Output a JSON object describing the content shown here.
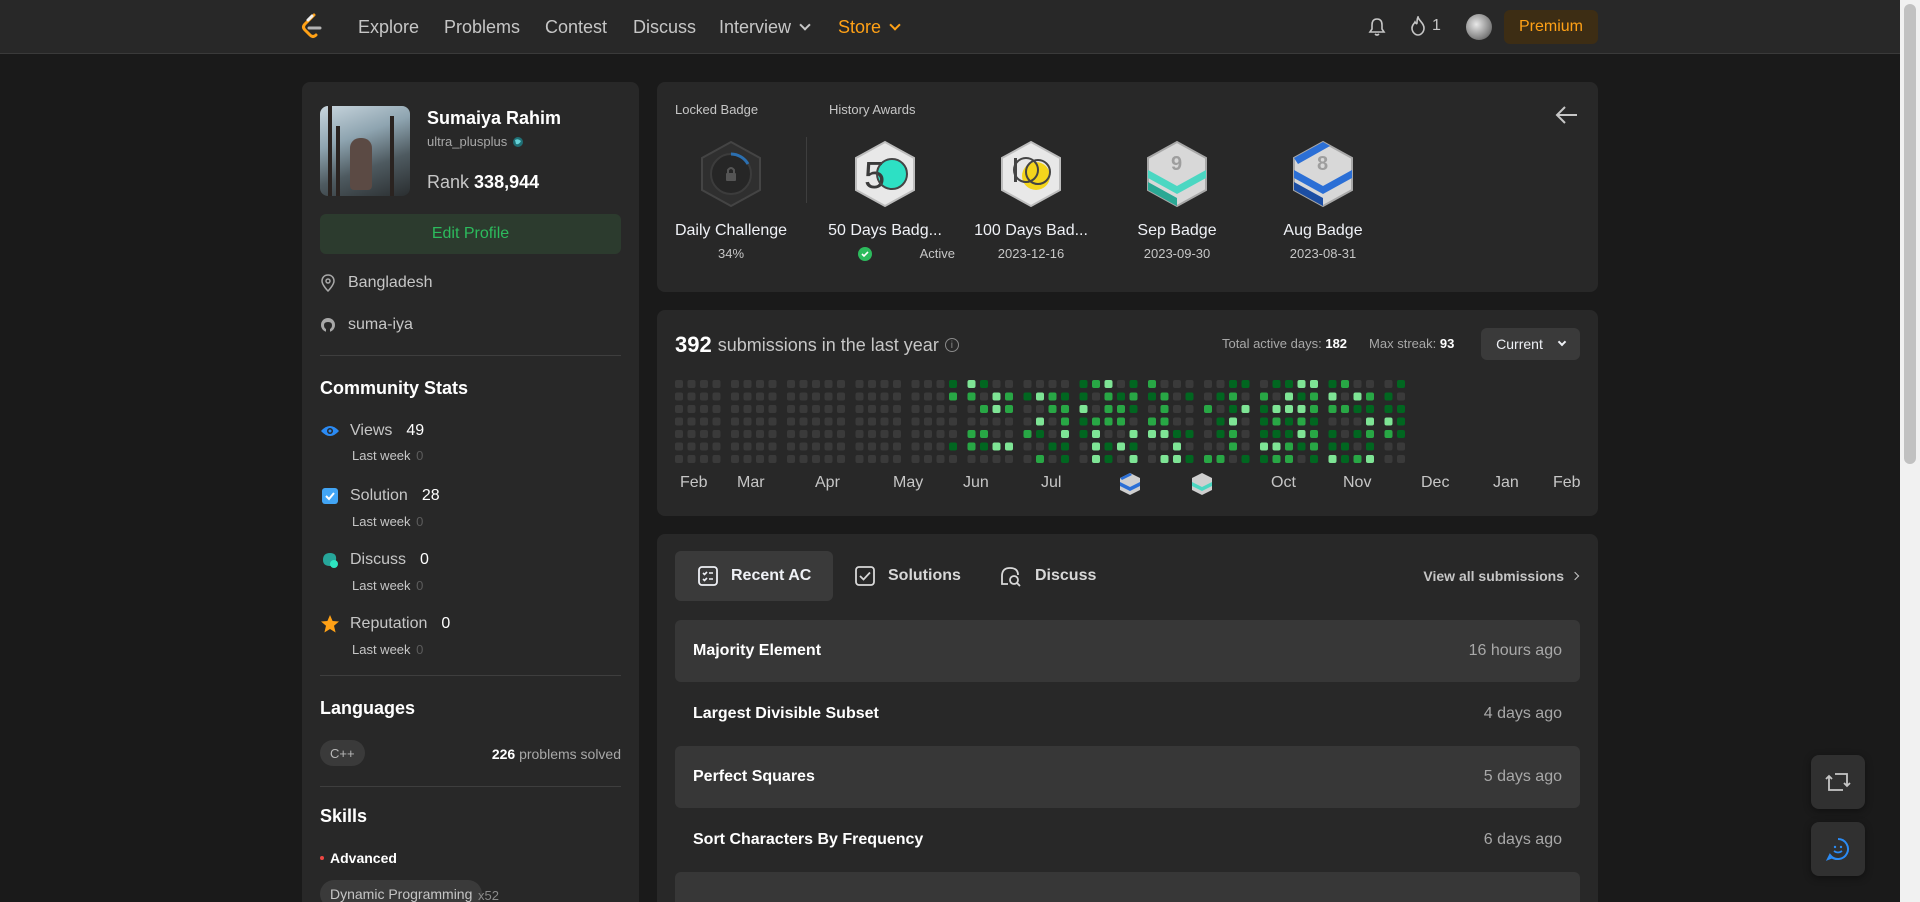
{
  "nav": {
    "links": [
      "Explore",
      "Problems",
      "Contest",
      "Discuss",
      "Interview",
      "Store"
    ],
    "streak_count": "1",
    "premium_label": "Premium"
  },
  "profile": {
    "name": "Sumaiya Rahim",
    "handle": "ultra_plusplus",
    "rank_label": "Rank",
    "rank_value": "338,944",
    "edit_label": "Edit Profile",
    "location": "Bangladesh",
    "github": "suma-iya"
  },
  "community": {
    "title": "Community Stats",
    "stats": [
      {
        "label": "Views",
        "value": "49",
        "sub_label": "Last week",
        "sub_value": "0",
        "icon": "eye-icon"
      },
      {
        "label": "Solution",
        "value": "28",
        "sub_label": "Last week",
        "sub_value": "0",
        "icon": "solution-icon"
      },
      {
        "label": "Discuss",
        "value": "0",
        "sub_label": "Last week",
        "sub_value": "0",
        "icon": "discuss-icon"
      },
      {
        "label": "Reputation",
        "value": "0",
        "sub_label": "Last week",
        "sub_value": "0",
        "icon": "star-icon"
      }
    ]
  },
  "languages": {
    "title": "Languages",
    "items": [
      {
        "name": "C++",
        "count": "226",
        "suffix": "problems solved"
      }
    ]
  },
  "skills": {
    "title": "Skills",
    "level": "Advanced",
    "items": [
      {
        "name": "Dynamic Programming",
        "count": "x52"
      }
    ]
  },
  "badges": {
    "locked_label": "Locked Badge",
    "history_label": "History Awards",
    "locked": {
      "name": "Daily Challenge",
      "sub": "34%"
    },
    "awards": [
      {
        "name": "50 Days Badg...",
        "sub": "Active"
      },
      {
        "name": "100 Days Bad...",
        "sub": "2023-12-16"
      },
      {
        "name": "Sep Badge",
        "sub": "2023-09-30"
      },
      {
        "name": "Aug Badge",
        "sub": "2023-08-31"
      }
    ]
  },
  "submissions": {
    "count": "392",
    "label": "submissions in the last year",
    "active_days_label": "Total active days:",
    "active_days": "182",
    "max_streak_label": "Max streak:",
    "max_streak": "93",
    "range": "Current",
    "months": [
      "Feb",
      "Mar",
      "Apr",
      "May",
      "Jun",
      "Jul",
      "Oct",
      "Nov",
      "Dec",
      "Jan",
      "Feb"
    ],
    "colors": {
      "empty": "#3a3a3a",
      "l1": "#016620",
      "l2": "#28a745",
      "l3": "#7ee495"
    }
  },
  "recent": {
    "tabs": [
      "Recent AC",
      "Solutions",
      "Discuss"
    ],
    "view_all": "View all submissions",
    "items": [
      {
        "title": "Majority Element",
        "time": "16 hours ago"
      },
      {
        "title": "Largest Divisible Subset",
        "time": "4 days ago"
      },
      {
        "title": "Perfect Squares",
        "time": "5 days ago"
      },
      {
        "title": "Sort Characters By Frequency",
        "time": "6 days ago"
      }
    ]
  }
}
